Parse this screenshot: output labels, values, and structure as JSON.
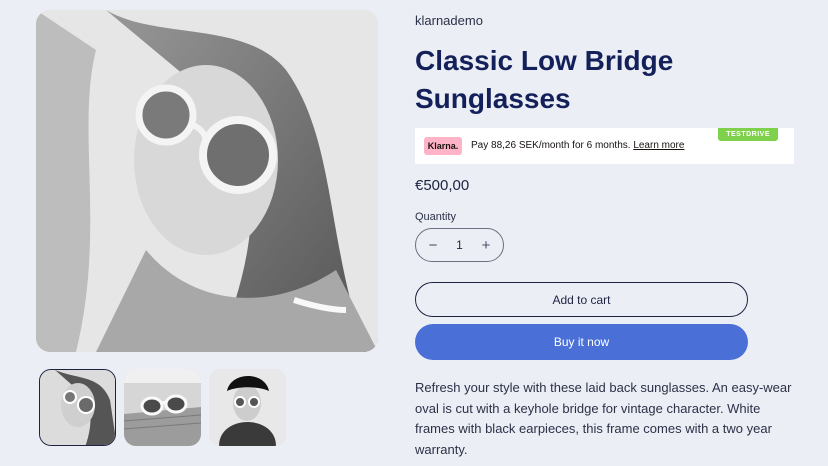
{
  "gallery": {
    "main_image": "woman-sunglasses-photo",
    "thumbnails": [
      {
        "name": "woman-sunglasses-photo",
        "active": true
      },
      {
        "name": "sunglasses-on-table-photo",
        "active": false
      },
      {
        "name": "woman-hat-sunglasses-photo",
        "active": false
      }
    ]
  },
  "product": {
    "vendor": "klarnademo",
    "title": "Classic Low Bridge Sunglasses",
    "price": "€500,00",
    "description": "Refresh your style with these laid back sunglasses. An easy-wear oval is cut with a keyhole bridge for vintage character. White frames with black earpieces, this frame comes with a two year warranty."
  },
  "klarna": {
    "badge": "Klarna.",
    "message": "Pay 88,26 SEK/month for 6 months.",
    "link": "Learn more",
    "tag": "TESTDRIVE"
  },
  "quantity": {
    "label": "Quantity",
    "value": "1",
    "minus": "−",
    "plus": "+"
  },
  "actions": {
    "add_to_cart": "Add to cart",
    "buy_now": "Buy it now"
  },
  "colors": {
    "background": "#eceef5",
    "title": "#13205a",
    "buy_button": "#4a70d8",
    "klarna_pink": "#ffb3c7",
    "testdrive_green": "#7fd04a"
  }
}
